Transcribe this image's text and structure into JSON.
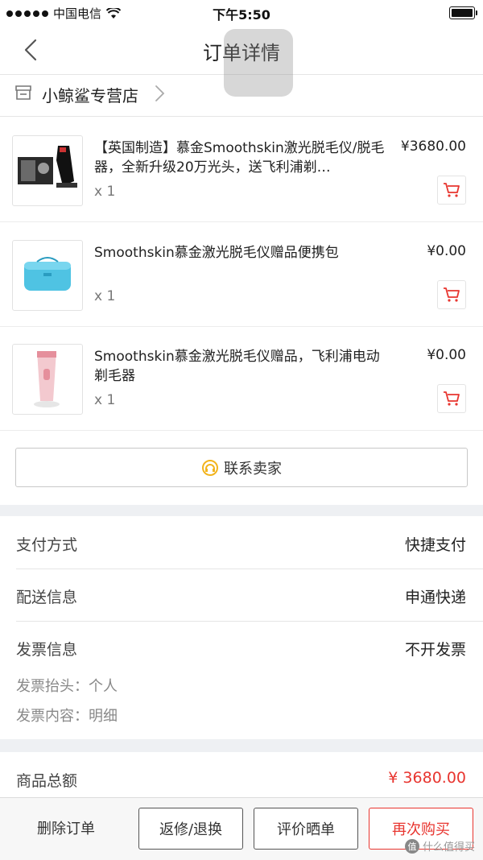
{
  "status_bar": {
    "carrier": "中国电信",
    "time": "下午5:50"
  },
  "header": {
    "title": "订单详情"
  },
  "store": {
    "name": "小鲸鲨专营店"
  },
  "products": [
    {
      "title": "【英国制造】慕金Smoothskin激光脱毛仪/脱毛器，全新升级20万光头，送飞利浦剃…",
      "price": "¥3680.00",
      "qty": "x 1"
    },
    {
      "title": "Smoothskin慕金激光脱毛仪赠品便携包",
      "price": "¥0.00",
      "qty": "x 1"
    },
    {
      "title": "Smoothskin慕金激光脱毛仪赠品，飞利浦电动剃毛器",
      "price": "¥0.00",
      "qty": "x 1"
    }
  ],
  "contact": {
    "label": "联系卖家"
  },
  "payment": {
    "label": "支付方式",
    "value": "快捷支付"
  },
  "shipping": {
    "label": "配送信息",
    "value": "申通快递"
  },
  "invoice": {
    "label": "发票信息",
    "value": "不开发票",
    "title_line": "发票抬头：个人",
    "content_line": "发票内容：明细"
  },
  "total": {
    "label": "商品总额",
    "value": "¥ 3680.00"
  },
  "bottom_bar": {
    "delete_label": "删除订单",
    "return_label": "返修/退换",
    "review_label": "评价晒单",
    "rebuy_label": "再次购买"
  },
  "watermark": {
    "text": "什么值得买",
    "logo_text": "值"
  },
  "colors": {
    "accent_red": "#e8352f",
    "background_band": "#eef0f3"
  }
}
